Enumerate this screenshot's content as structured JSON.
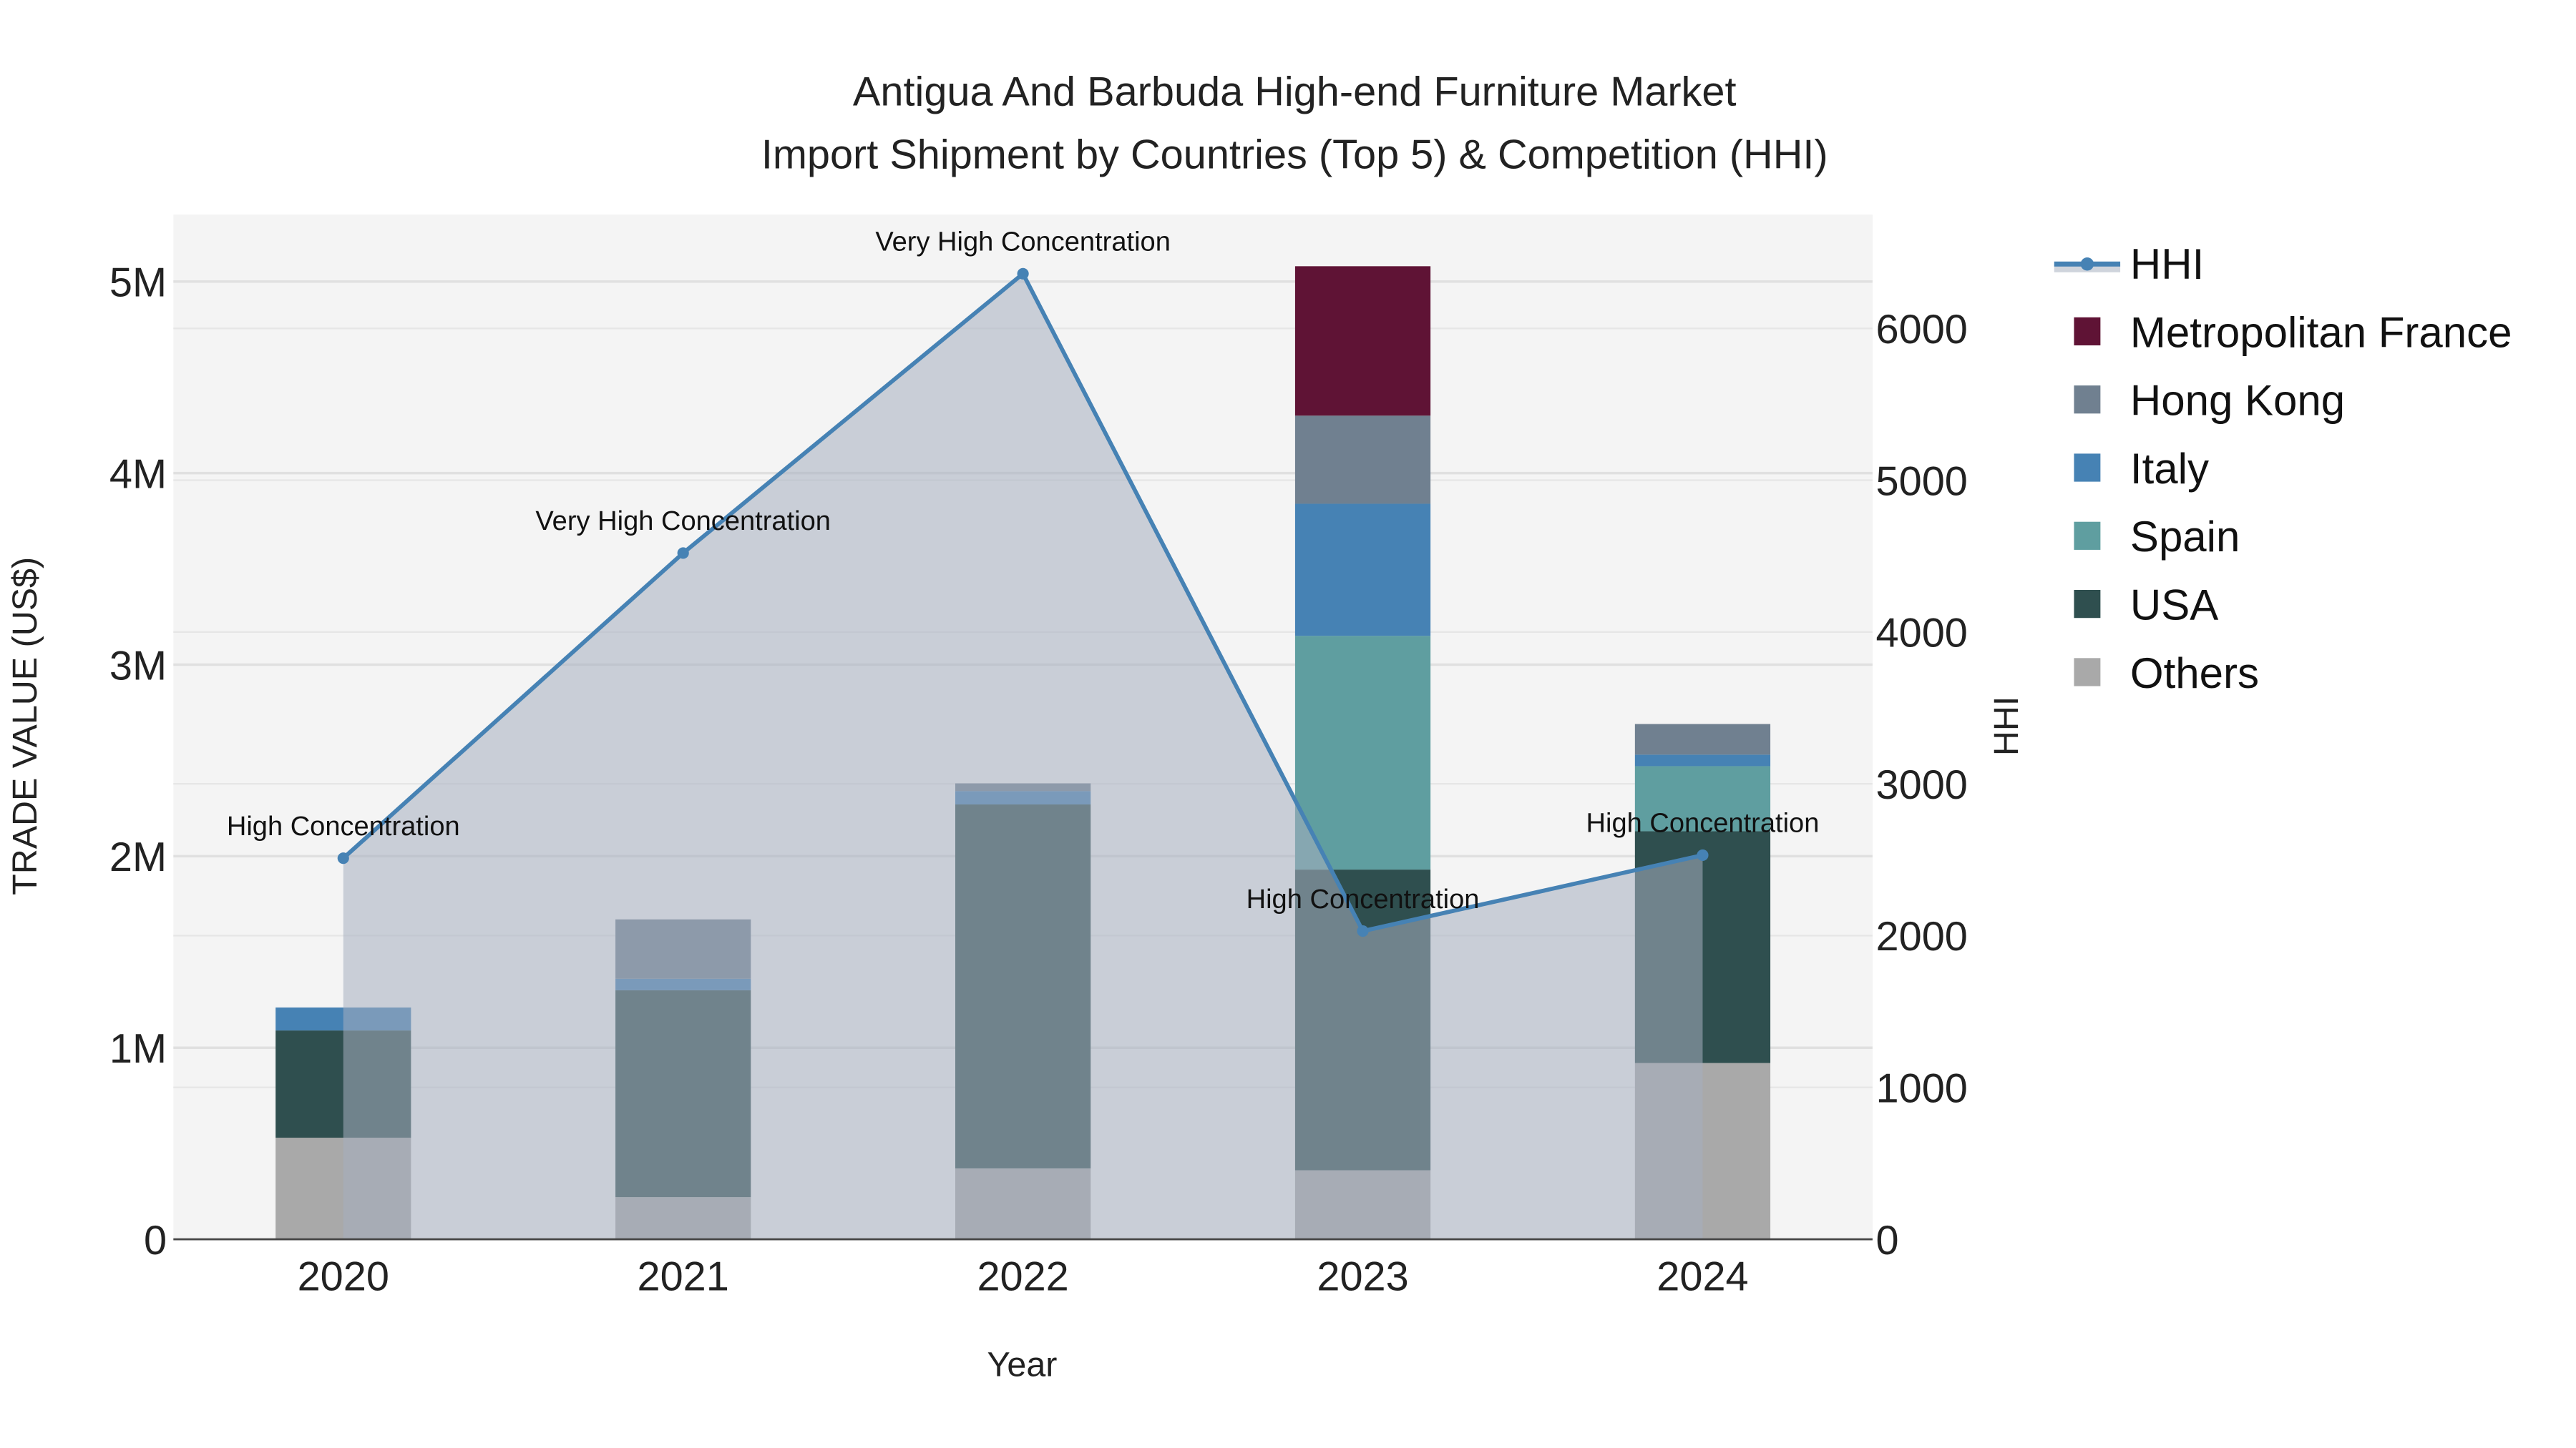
{
  "chart_data": {
    "type": "bar",
    "stacked": true,
    "title": "Antigua And Barbuda High-end Furniture Market",
    "subtitle": "Import Shipment by Countries (Top 5) & Competition (HHI)",
    "xlabel": "Year",
    "ylabel": "TRADE VALUE (US$)",
    "y2label": "HHI",
    "categories": [
      "2020",
      "2021",
      "2022",
      "2023",
      "2024"
    ],
    "ylim": [
      0,
      5350000
    ],
    "y2lim": [
      0,
      6750
    ],
    "yticks": [
      {
        "v": 0,
        "label": "0"
      },
      {
        "v": 1000000,
        "label": "1M"
      },
      {
        "v": 2000000,
        "label": "2M"
      },
      {
        "v": 3000000,
        "label": "3M"
      },
      {
        "v": 4000000,
        "label": "4M"
      },
      {
        "v": 5000000,
        "label": "5M"
      }
    ],
    "y2ticks": [
      {
        "v": 0,
        "label": "0"
      },
      {
        "v": 1000,
        "label": "1000"
      },
      {
        "v": 2000,
        "label": "2000"
      },
      {
        "v": 3000,
        "label": "3000"
      },
      {
        "v": 4000,
        "label": "4000"
      },
      {
        "v": 5000,
        "label": "5000"
      },
      {
        "v": 6000,
        "label": "6000"
      }
    ],
    "grid": true,
    "legend_position": "right",
    "series": [
      {
        "name": "Others",
        "color": "#a9a9a9",
        "values": [
          530000,
          220000,
          370000,
          360000,
          920000
        ]
      },
      {
        "name": "USA",
        "color": "#2f4f4f",
        "values": [
          560000,
          1080000,
          1900000,
          1570000,
          1210000
        ]
      },
      {
        "name": "Spain",
        "color": "#5f9ea0",
        "values": [
          0,
          0,
          0,
          1220000,
          340000
        ]
      },
      {
        "name": "Italy",
        "color": "#4682b4",
        "values": [
          120000,
          60000,
          70000,
          690000,
          60000
        ]
      },
      {
        "name": "Hong Kong",
        "color": "#708090",
        "values": [
          0,
          310000,
          40000,
          460000,
          160000
        ]
      },
      {
        "name": "Metropolitan France",
        "color": "#5f1335",
        "values": [
          0,
          0,
          0,
          780000,
          0
        ]
      }
    ],
    "hhi": {
      "name": "HHI",
      "color": "#4682b4",
      "values": [
        2510,
        4520,
        6360,
        2030,
        2530
      ],
      "annotations": [
        "High Concentration",
        "Very High Concentration",
        "Very High Concentration",
        "High Concentration",
        "High Concentration"
      ]
    },
    "legend": [
      "HHI",
      "Metropolitan France",
      "Hong Kong",
      "Italy",
      "Spain",
      "USA",
      "Others"
    ]
  }
}
